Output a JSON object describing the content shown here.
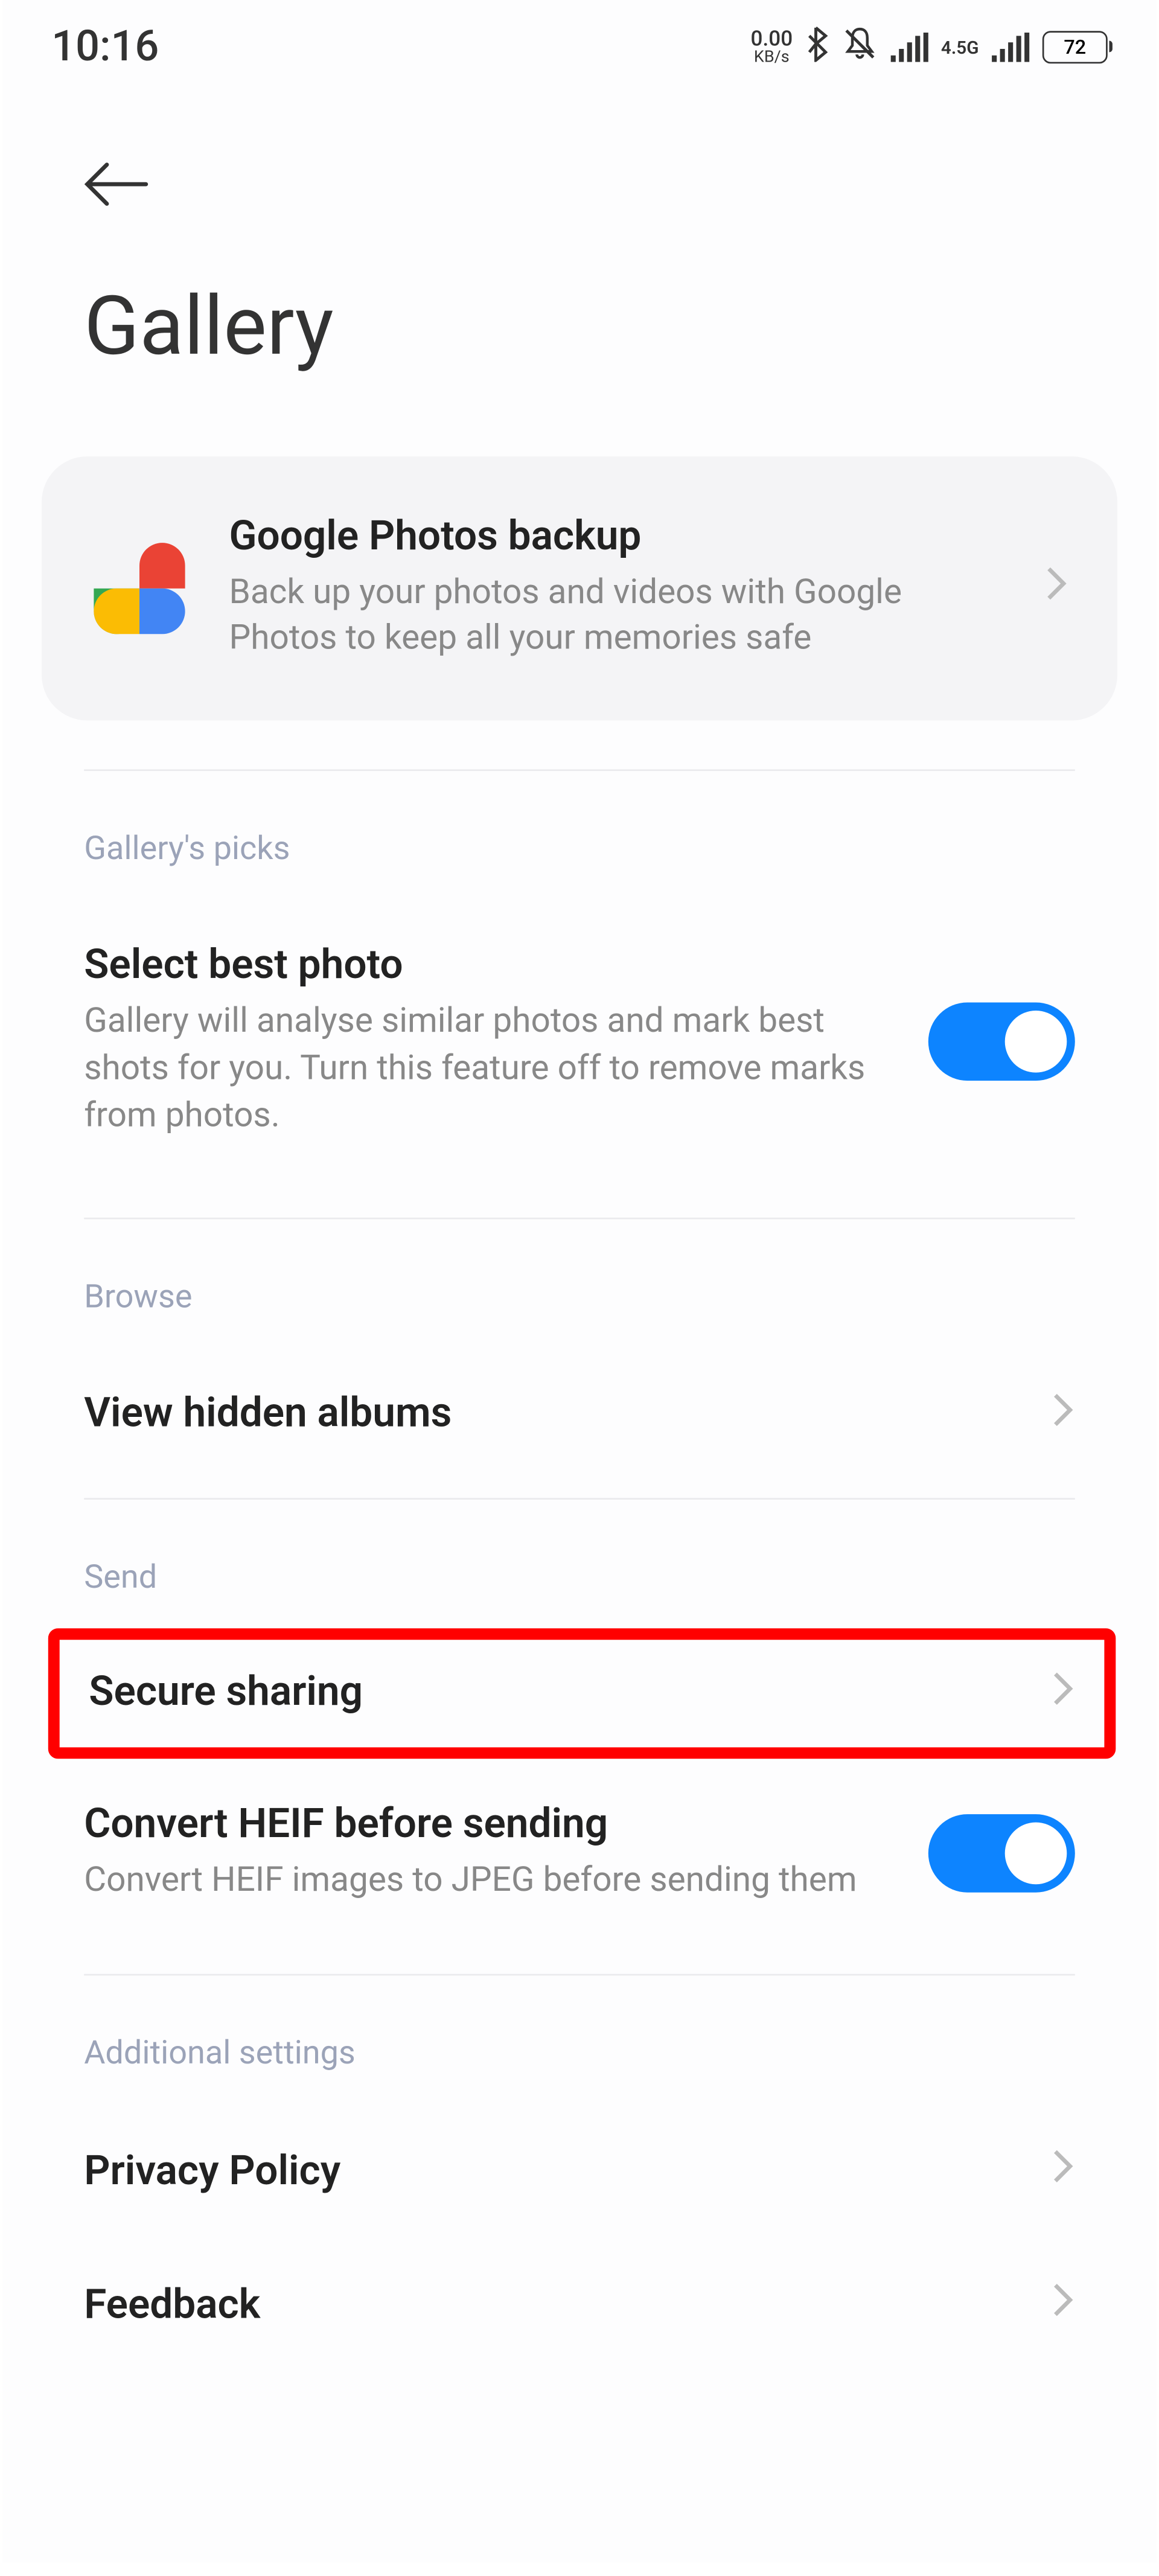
{
  "status_bar": {
    "time": "10:16",
    "speed_value": "0.00",
    "speed_unit": "KB/s",
    "network_type": "4.5G",
    "battery": "72"
  },
  "page_title": "Gallery",
  "backup_card": {
    "title": "Google Photos backup",
    "description": "Back up your photos and videos with Google Photos to keep all your memories safe"
  },
  "sections": {
    "gallerys_picks": {
      "header": "Gallery's picks",
      "select_best_photo": {
        "title": "Select best photo",
        "description": "Gallery will analyse similar photos and mark best shots for you. Turn this feature off to remove marks from photos.",
        "enabled": true
      }
    },
    "browse": {
      "header": "Browse",
      "view_hidden": "View hidden albums"
    },
    "send": {
      "header": "Send",
      "secure_sharing": "Secure sharing",
      "convert_heif": {
        "title": "Convert HEIF before sending",
        "description": "Convert HEIF images to JPEG before sending them",
        "enabled": true
      }
    },
    "additional": {
      "header": "Additional settings",
      "privacy_policy": "Privacy Policy",
      "feedback": "Feedback"
    }
  }
}
